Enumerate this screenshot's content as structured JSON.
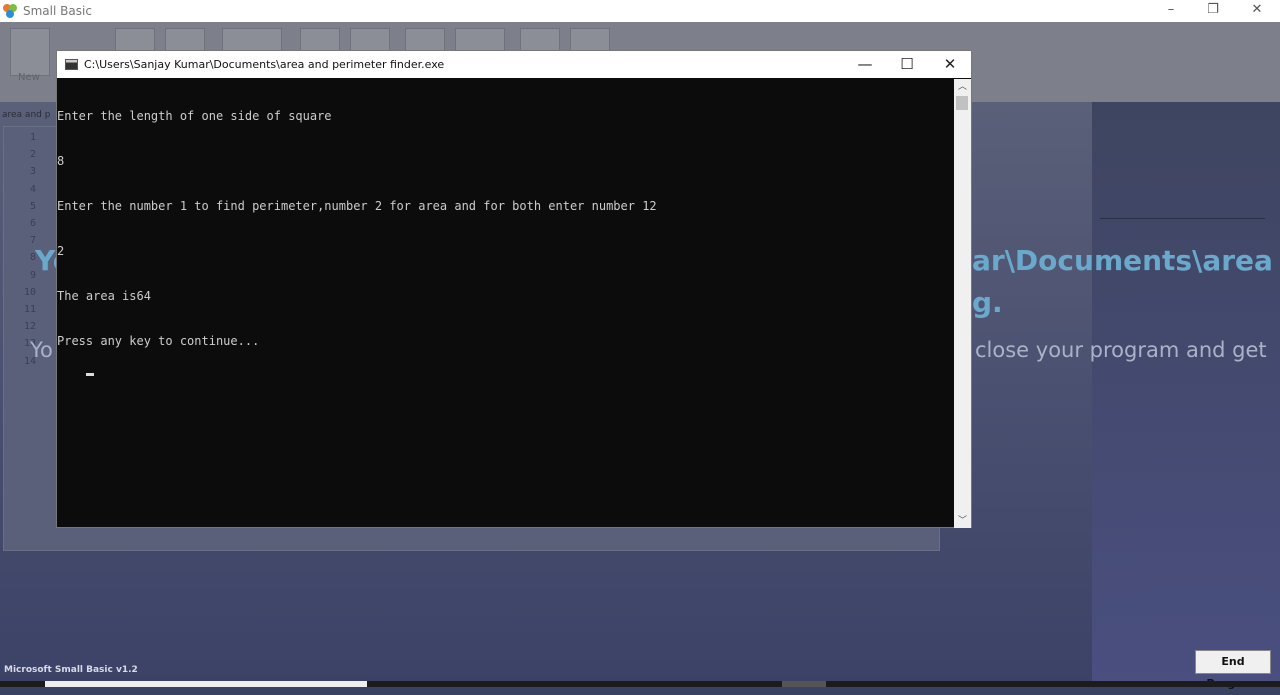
{
  "app": {
    "title": "Small Basic",
    "ribbon_new_label": "New"
  },
  "editor": {
    "doc_tab": "area and p",
    "line_numbers": [
      "1",
      "2",
      "3",
      "4",
      "5",
      "6",
      "7",
      "8",
      "9",
      "10",
      "11",
      "12",
      "13",
      "14"
    ]
  },
  "overlay": {
    "heading_left": "Yo",
    "heading_right_1": "ar\\Documents\\area",
    "heading_right_2": "g.",
    "sub_left": "Yo",
    "sub_right": "close your program and get"
  },
  "status": {
    "version": "Microsoft Small Basic v1.2",
    "end_program": "End Program"
  },
  "console": {
    "title": "C:\\Users\\Sanjay Kumar\\Documents\\area and perimeter finder.exe",
    "lines": [
      "Enter the length of one side of square",
      "8",
      "Enter the number 1 to find perimeter,number 2 for area and for both enter number 12",
      "2",
      "The area is64",
      "Press any key to continue..."
    ]
  }
}
